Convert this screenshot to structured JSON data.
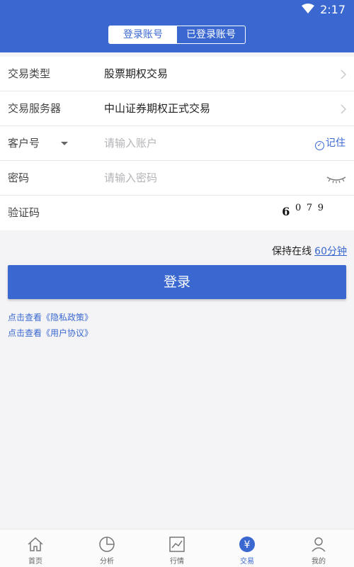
{
  "status": {
    "time": "2:17"
  },
  "header": {
    "segments": [
      {
        "label": "登录账号"
      },
      {
        "label": "已登录账号"
      }
    ]
  },
  "form": {
    "trade_type": {
      "label": "交易类型",
      "value": "股票期权交易"
    },
    "server": {
      "label": "交易服务器",
      "value": "中山证券期权正式交易"
    },
    "account": {
      "label": "客户号",
      "placeholder": "请输入账户",
      "remember": "记住"
    },
    "password": {
      "label": "密码",
      "placeholder": "请输入密码"
    },
    "captcha": {
      "label": "验证码",
      "code": [
        "6",
        "0",
        "7",
        "9"
      ]
    }
  },
  "keep_online": {
    "label": "保持在线",
    "value": "60分钟"
  },
  "login_button": "登录",
  "links": {
    "privacy": "点击查看《隐私政策》",
    "agreement": "点击查看《用户协议》"
  },
  "tabs": [
    {
      "label": "首页"
    },
    {
      "label": "分析"
    },
    {
      "label": "行情"
    },
    {
      "label": "交易"
    },
    {
      "label": "我的"
    }
  ],
  "colors": {
    "primary": "#3a68d0"
  }
}
